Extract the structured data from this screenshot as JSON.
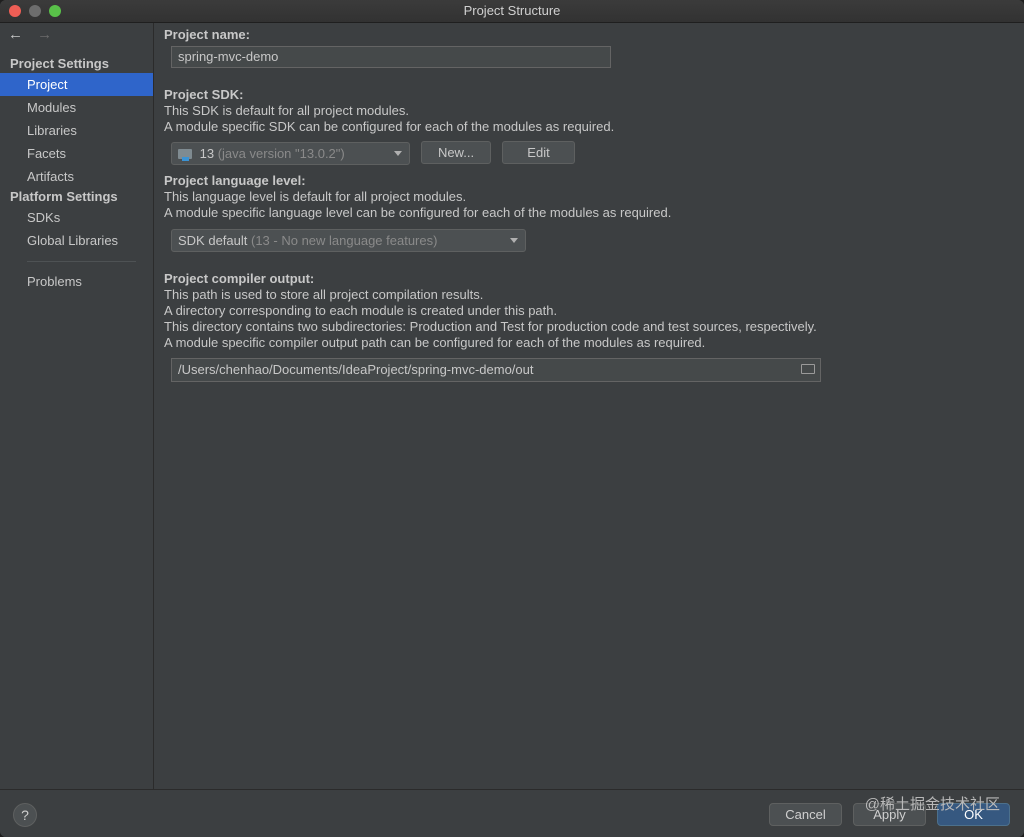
{
  "window": {
    "title": "Project Structure"
  },
  "sidebar": {
    "project_settings_header": "Project Settings",
    "project_settings_items": [
      "Project",
      "Modules",
      "Libraries",
      "Facets",
      "Artifacts"
    ],
    "platform_settings_header": "Platform Settings",
    "platform_settings_items": [
      "SDKs",
      "Global Libraries"
    ],
    "problems": "Problems",
    "selected": "Project"
  },
  "main": {
    "project_name_label": "Project name:",
    "project_name_value": "spring-mvc-demo",
    "sdk_label": "Project SDK:",
    "sdk_desc_1": "This SDK is default for all project modules.",
    "sdk_desc_2": "A module specific SDK can be configured for each of the modules as required.",
    "sdk_value": "13",
    "sdk_version": "(java version \"13.0.2\")",
    "sdk_new_button": "New...",
    "sdk_edit_button": "Edit",
    "language_label": "Project language level:",
    "language_desc_1": "This language level is default for all project modules.",
    "language_desc_2": "A module specific language level can be configured for each of the modules as required.",
    "language_value": "SDK default",
    "language_detail": "(13 - No new language features)",
    "compiler_label": "Project compiler output:",
    "compiler_desc_1": "This path is used to store all project compilation results.",
    "compiler_desc_2": "A directory corresponding to each module is created under this path.",
    "compiler_desc_3": "This directory contains two subdirectories: Production and Test for production code and test sources, respectively.",
    "compiler_desc_4": "A module specific compiler output path can be configured for each of the modules as required.",
    "compiler_path": "/Users/chenhao/Documents/IdeaProject/spring-mvc-demo/out"
  },
  "footer": {
    "help": "?",
    "cancel": "Cancel",
    "apply": "Apply",
    "ok": "OK",
    "watermark": "@稀土掘金技术社区"
  },
  "colors": {
    "selection": "#2f65ca",
    "background": "#3c3f41",
    "default_button": "#365880"
  }
}
